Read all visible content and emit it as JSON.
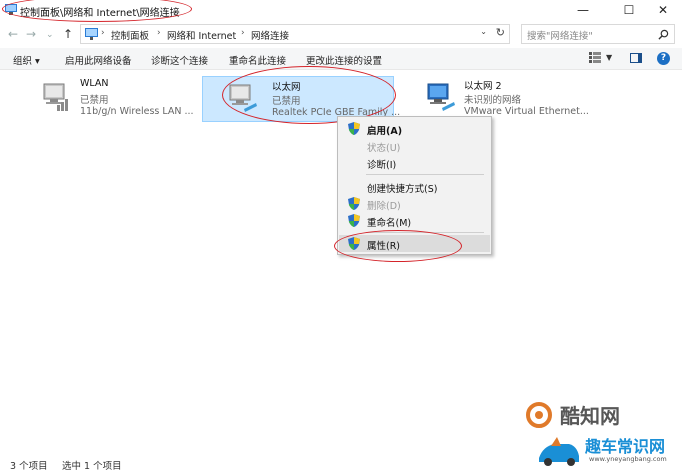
{
  "window": {
    "title": "控制面板\\网络和 Internet\\网络连接",
    "minimize": "—",
    "maximize": "☐",
    "close": "✕"
  },
  "nav": {
    "back": "←",
    "forward": "→",
    "dropdown": "⌄",
    "up": "↑"
  },
  "address": {
    "crumbs": [
      "控制面板",
      "网络和 Internet",
      "网络连接"
    ],
    "separator": "›",
    "dropdown": "⌄",
    "refresh": "↻"
  },
  "search": {
    "placeholder": "搜索\"网络连接\"",
    "icon": "search-icon"
  },
  "toolbar": {
    "organize": "组织 ▾",
    "enable": "启用此网络设备",
    "diagnose": "诊断这个连接",
    "rename": "重命名此连接",
    "change_settings": "更改此连接的设置",
    "help": "?"
  },
  "adapters": [
    {
      "name": "WLAN",
      "status": "已禁用",
      "device": "11b/g/n  Wireless LAN ...",
      "icon": "network-adapter-disabled-icon"
    },
    {
      "name": "以太网",
      "status": "已禁用",
      "device": "Realtek PCIe GBE Family ...",
      "icon": "network-adapter-disabled-icon",
      "selected": true
    },
    {
      "name": "以太网 2",
      "status": "未识别的网络",
      "device": "VMware Virtual Ethernet...",
      "icon": "network-adapter-enabled-icon"
    }
  ],
  "context_menu": {
    "items": [
      {
        "label": "启用(A)",
        "enabled": true,
        "default": true,
        "shield": true
      },
      {
        "label": "状态(U)",
        "enabled": false,
        "shield": false
      },
      {
        "label": "诊断(I)",
        "enabled": true,
        "shield": false
      },
      {
        "label": "创建快捷方式(S)",
        "enabled": true,
        "shield": false
      },
      {
        "label": "删除(D)",
        "enabled": false,
        "shield": true
      },
      {
        "label": "重命名(M)",
        "enabled": true,
        "shield": true
      },
      {
        "label": "属性(R)",
        "enabled": true,
        "shield": true,
        "highlighted": true
      }
    ]
  },
  "statusbar": {
    "count": "3 个项目",
    "selected": "选中 1 个项目"
  },
  "watermark": {
    "line1": "酷知网",
    "line2": "趣车常识网",
    "url": "www.yneyangbang.com"
  },
  "colors": {
    "accent": "#1c6fc4",
    "selection": "#cce8ff",
    "annotation": "#d4242a"
  }
}
